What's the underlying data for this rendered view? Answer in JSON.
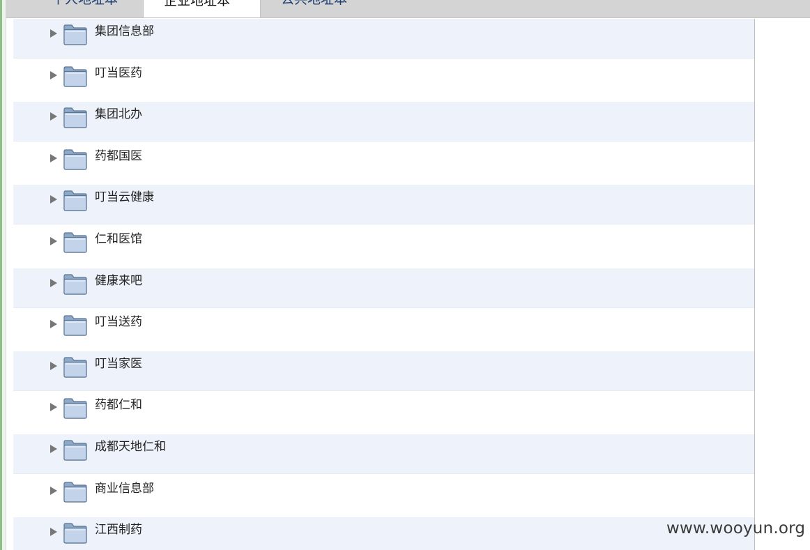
{
  "tabs": [
    {
      "label": "个人地址本",
      "active": false
    },
    {
      "label": "企业地址本",
      "active": true
    },
    {
      "label": "公共地址本",
      "active": false
    }
  ],
  "tree": {
    "expand_icon": "triangle-right-icon",
    "node_icon": "folder-icon",
    "items": [
      {
        "label": "集团信息部"
      },
      {
        "label": "叮当医药"
      },
      {
        "label": "集团北办"
      },
      {
        "label": "药都国医"
      },
      {
        "label": "叮当云健康"
      },
      {
        "label": "仁和医馆"
      },
      {
        "label": "健康来吧"
      },
      {
        "label": "叮当送药"
      },
      {
        "label": "叮当家医"
      },
      {
        "label": "药都仁和"
      },
      {
        "label": "成都天地仁和"
      },
      {
        "label": "商业信息部"
      },
      {
        "label": "江西制药"
      }
    ]
  },
  "watermark": "www.wooyun.org",
  "colors": {
    "tab_text": "#1d3f73",
    "row_alt_background": "#eef3fb",
    "folder_fill": "#b9cce4",
    "folder_stroke": "#5a7594",
    "arrow": "#777777"
  }
}
